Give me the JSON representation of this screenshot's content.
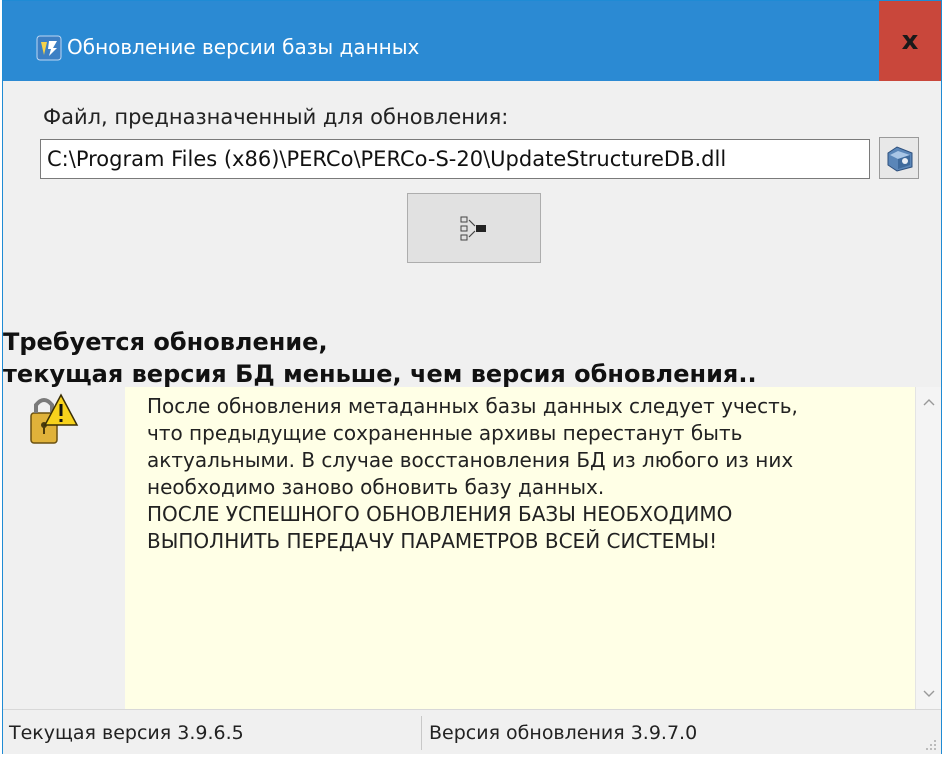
{
  "window": {
    "title": "Обновление версии базы данных",
    "close_label": "x"
  },
  "file": {
    "label": "Файл, предназначенный для обновления:",
    "path": "C:\\Program Files (x86)\\PERCo\\PERCo-S-20\\UpdateStructureDB.dll"
  },
  "status": {
    "heading_line1": "Требуется обновление,",
    "heading_line2": "текущая версия БД меньше, чем версия обновления.."
  },
  "message": {
    "text": "После обновления метаданных базы данных следует учесть,\nчто предыдущие сохраненные архивы перестанут быть\nактуальными. В случае восстановления БД из любого из них\nнеобходимо заново обновить базу данных.\nПОСЛЕ УСПЕШНОГО ОБНОВЛЕНИЯ БАЗЫ НЕОБХОДИМО\nВЫПОЛНИТЬ ПЕРЕДАЧУ ПАРАМЕТРОВ ВСЕЙ СИСТЕМЫ!"
  },
  "statusbar": {
    "current_version": "Текущая версия 3.9.6.5",
    "update_version": "Версия обновления 3.9.7.0"
  },
  "icons": {
    "app": "database-update-icon",
    "browse": "folder-browse-icon",
    "run": "run-update-icon",
    "warning": "warning-lock-icon",
    "scroll_up": "chevron-up-icon",
    "scroll_down": "chevron-down-icon"
  },
  "colors": {
    "titlebar": "#2b8ad3",
    "close": "#c9473b",
    "message_bg": "#ffffe6"
  }
}
